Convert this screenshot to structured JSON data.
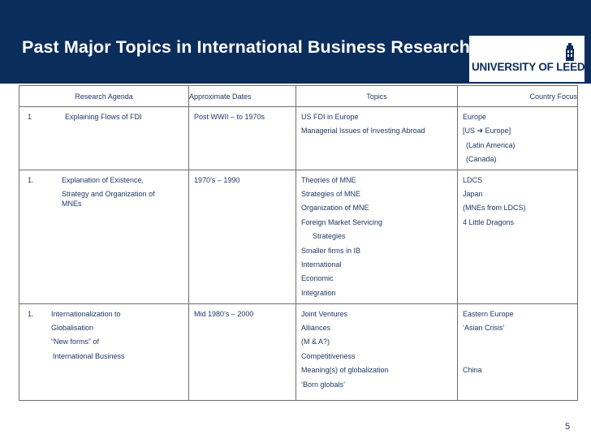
{
  "header": {
    "title": "Past Major Topics in International Business Research",
    "logo_text": "UNIVERSITY OF LEEDS"
  },
  "table": {
    "headers": [
      "Research Agenda",
      "Approximate Dates",
      "Topics",
      "Country Focus"
    ],
    "rows": [
      {
        "number": "1",
        "agenda": [
          "Explaining Flows of FDI"
        ],
        "dates": "Post WWII – to 1970s",
        "topics": [
          "US FDI in Europe",
          "Managerial Issues of Investing Abroad"
        ],
        "country": [
          "Europe",
          "[US ➔ Europe]",
          "(Latin America)",
          "(Canada)"
        ]
      },
      {
        "number": "1.",
        "agenda": [
          "Explanation of Existence,",
          "Strategy and Organization of",
          "MNEs"
        ],
        "dates": "1970’s – 1990",
        "topics": [
          "Theories of MNE",
          "Strategies of MNE",
          "Organization of MNE",
          "Foreign Market Servicing",
          "Strategies",
          "Smaller firms in IB",
          "International",
          "Economic",
          "Integration"
        ],
        "country": [
          "LDCS",
          "Japan",
          "(MNEs from LDCS)",
          "4 Little Dragons"
        ]
      },
      {
        "number": "1.",
        "agenda": [
          "Internationalization to",
          "Globalisation",
          "“New forms” of",
          "International Business"
        ],
        "dates": "Mid 1980’s – 2000",
        "topics": [
          "Joint Ventures",
          "Alliances",
          "(M & A?)",
          "Competitiveness",
          "Meaning(s) of globalization",
          "‘Born globals’"
        ],
        "country": [
          "Eastern Europe",
          "‘Asian Crisis’",
          "",
          "",
          "China"
        ]
      }
    ]
  },
  "page_number": "5",
  "colors": {
    "header_bg": "#0b2d5b",
    "text": "#1f3864",
    "border": "#6e6e6e"
  }
}
